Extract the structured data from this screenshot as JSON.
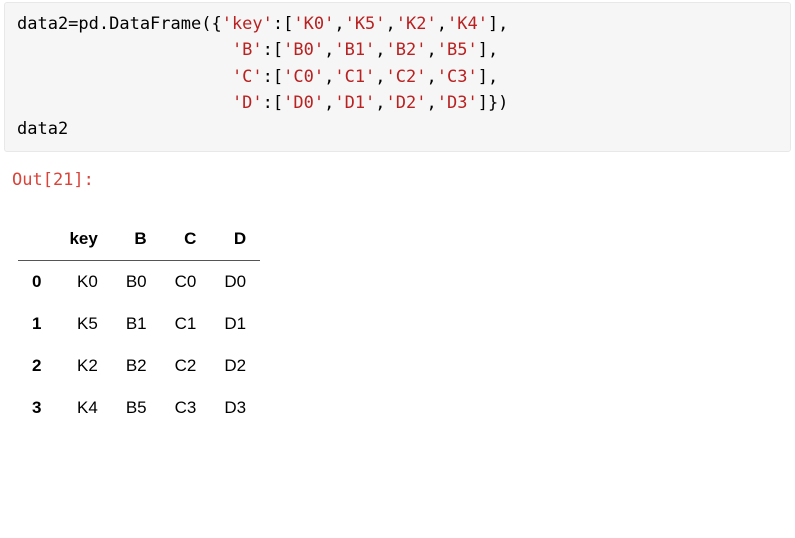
{
  "code": {
    "line1_pre": "data2=pd.DataFrame({",
    "k_key": "'key'",
    "colon_open": ":[",
    "v_k0": "'K0'",
    "v_k5": "'K5'",
    "v_k2": "'K2'",
    "v_k4": "'K4'",
    "close_comma": "],",
    "k_B": "'B'",
    "v_b0": "'B0'",
    "v_b1": "'B1'",
    "v_b2": "'B2'",
    "v_b5": "'B5'",
    "k_C": "'C'",
    "v_c0": "'C0'",
    "v_c1": "'C1'",
    "v_c2": "'C2'",
    "v_c3": "'C3'",
    "k_D": "'D'",
    "v_d0": "'D0'",
    "v_d1": "'D1'",
    "v_d2": "'D2'",
    "v_d3": "'D3'",
    "close_all": "]})",
    "line5": "data2",
    "comma": ",",
    "indent2": "                     "
  },
  "out_prompt": "Out[21]:",
  "table": {
    "columns": [
      "key",
      "B",
      "C",
      "D"
    ],
    "rows": [
      {
        "idx": "0",
        "cells": [
          "K0",
          "B0",
          "C0",
          "D0"
        ]
      },
      {
        "idx": "1",
        "cells": [
          "K5",
          "B1",
          "C1",
          "D1"
        ]
      },
      {
        "idx": "2",
        "cells": [
          "K2",
          "B2",
          "C2",
          "D2"
        ]
      },
      {
        "idx": "3",
        "cells": [
          "K4",
          "B5",
          "C3",
          "D3"
        ]
      }
    ]
  }
}
